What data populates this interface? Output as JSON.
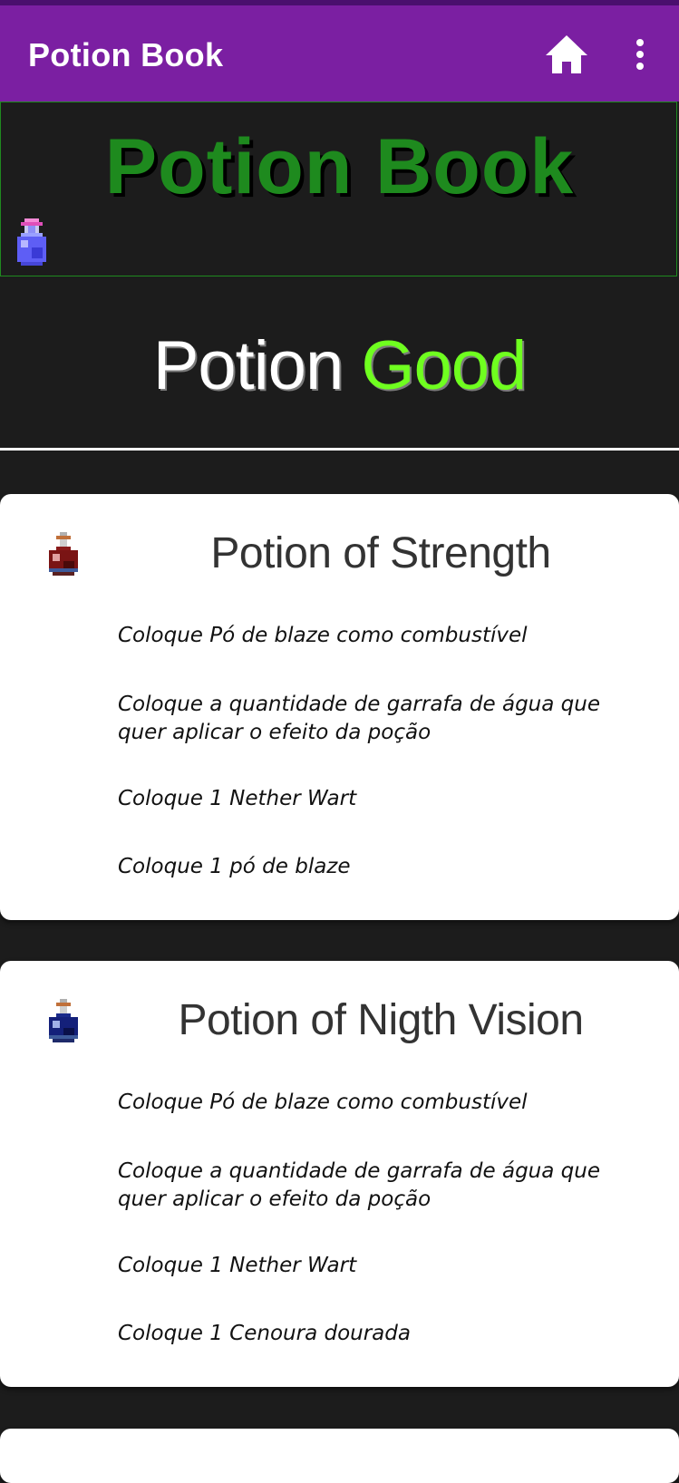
{
  "app_bar": {
    "title": "Potion Book",
    "home_icon": "home-icon",
    "menu_icon": "more-vert-icon",
    "background": "#7b1fa2"
  },
  "banner": {
    "title": "Potion Book",
    "title_color": "#1e8a1e",
    "icon": "purple-potion-icon"
  },
  "subtitle": {
    "word1": "Potion",
    "word2": "Good",
    "accent_color": "#6fff1f"
  },
  "cards": [
    {
      "title": "Potion of Strength",
      "icon": "strength-potion-icon",
      "steps": [
        "Coloque Pó de blaze como combustível",
        "Coloque a quantidade de garrafa de água que quer aplicar o efeito da poção",
        "Coloque 1 Nether Wart",
        "Coloque 1 pó de blaze"
      ]
    },
    {
      "title": "Potion of Nigth Vision",
      "icon": "night-vision-potion-icon",
      "steps": [
        "Coloque Pó de blaze como combustível",
        "Coloque a quantidade de garrafa de água que quer aplicar o efeito da poção",
        "Coloque 1 Nether Wart",
        "Coloque 1 Cenoura dourada"
      ]
    }
  ]
}
